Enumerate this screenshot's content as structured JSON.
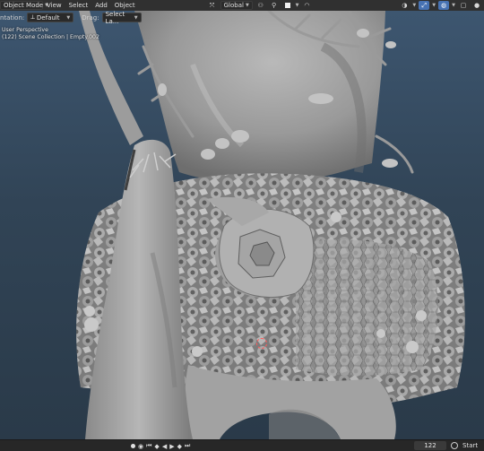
{
  "header": {
    "mode": "Object Mode",
    "menus": [
      "View",
      "Select",
      "Add",
      "Object"
    ],
    "transform_orientation": "Global",
    "icons": [
      "transform-pivot-icon",
      "snap-icon",
      "proportional-editing-icon",
      "viewport-gizmo-icon",
      "overlay-icon",
      "shading-icon"
    ]
  },
  "toolbar": {
    "orientation_label": "ntation:",
    "orientation_value": "Default",
    "drag_label": "Drag:",
    "drag_value": "Select La..."
  },
  "viewport": {
    "view_name": "User Perspective",
    "collection_info": "(122) Scene Collection | Empty.002"
  },
  "timeline": {
    "current_frame": "122",
    "start_label": "Start"
  },
  "colors": {
    "accent": "#4772b3",
    "header_bg": "#303030",
    "viewport_top": "#3d5670",
    "viewport_bottom": "#2a3a49",
    "model": "#a7a7a7"
  }
}
